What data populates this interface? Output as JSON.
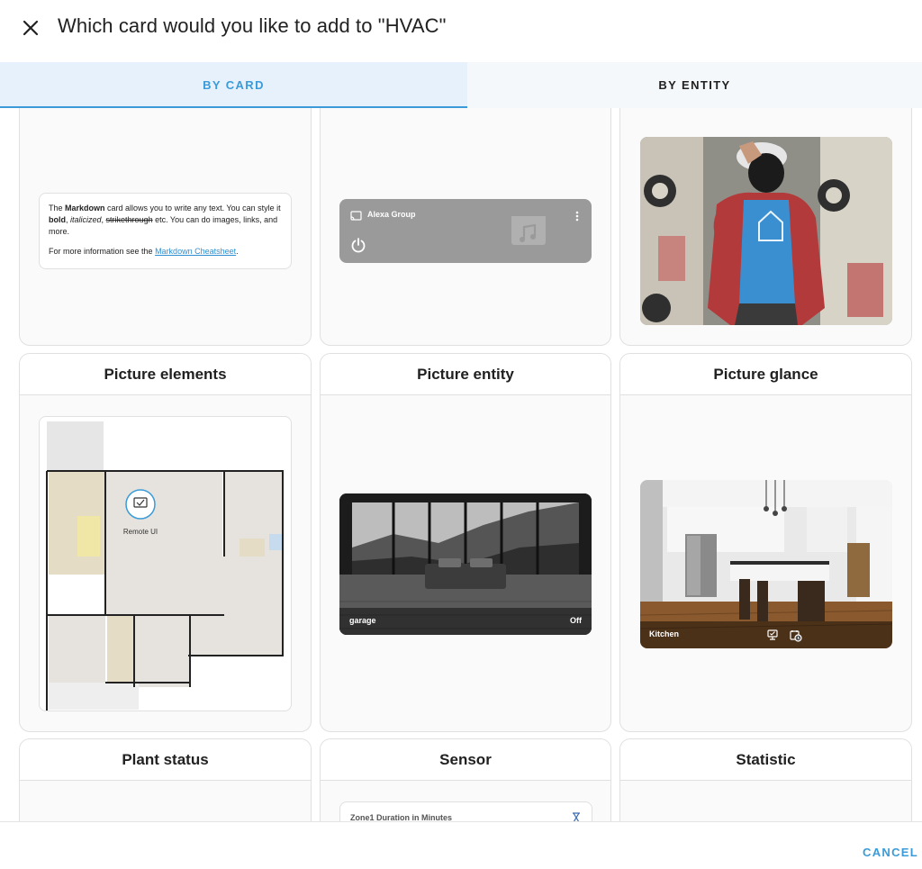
{
  "dialog": {
    "title": "Which card would you like to add to \"HVAC\"",
    "close_icon": "close-icon",
    "cancel_label": "CANCEL"
  },
  "tabs": [
    {
      "label": "BY CARD",
      "active": true
    },
    {
      "label": "BY ENTITY",
      "active": false
    }
  ],
  "colors": {
    "accent": "#3b9bd8",
    "tab_active_bg": "#e6f1fb",
    "card_bg": "#fafafa",
    "border": "#e0e0e0"
  },
  "cards": {
    "markdown": {
      "t1": "The ",
      "b1": "Markdown",
      "t2": " card allows you to write any text. You can style it ",
      "b2": "bold",
      "t3": ", ",
      "i1": "italicized",
      "t4": ", ",
      "s1": "strikethrough",
      "t5": " etc. You can do images, links, and more.",
      "p2": "For more information see the ",
      "link": "Markdown Cheatsheet",
      "p2_end": "."
    },
    "media_control": {
      "entity_name": "Alexa Group",
      "cast_icon": "cast-icon",
      "menu_icon": "more-vert-icon",
      "power_icon": "power-icon",
      "art_icon": "music-icon"
    },
    "picture": {
      "image": "person-photo"
    },
    "picture_elements": {
      "title": "Picture elements",
      "element_label": "Remote UI",
      "element_icon": "remote-ui-icon"
    },
    "picture_entity": {
      "title": "Picture entity",
      "entity_name": "garage",
      "state": "Off"
    },
    "picture_glance": {
      "title": "Picture glance",
      "entity_name": "Kitchen",
      "icon_1": "remote-ui-icon",
      "icon_2": "calendar-clock-icon"
    },
    "plant_status": {
      "title": "Plant status"
    },
    "sensor": {
      "title": "Sensor",
      "label": "Zone1 Duration in Minutes",
      "icon": "hourglass-icon"
    },
    "statistic": {
      "title": "Statistic"
    }
  }
}
